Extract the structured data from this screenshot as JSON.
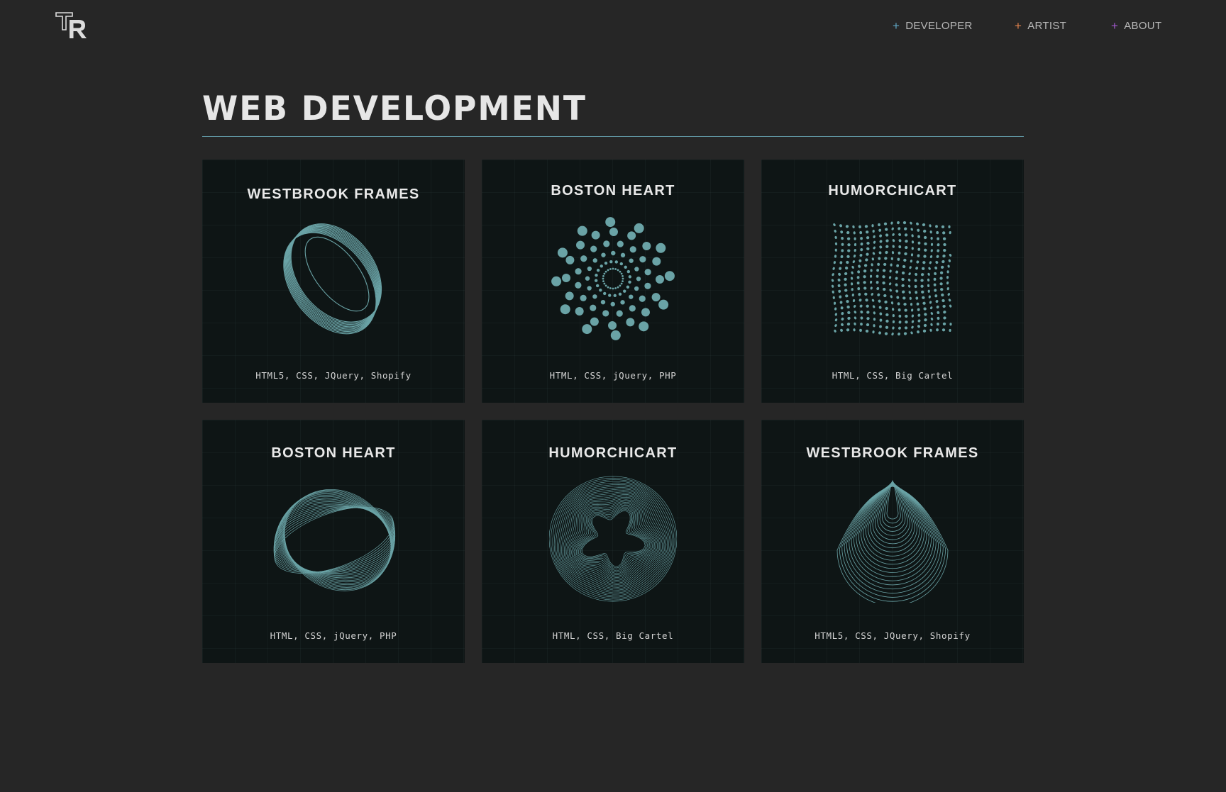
{
  "header": {
    "logo_text": "TR",
    "nav": [
      {
        "label": "DEVELOPER",
        "plus": "+",
        "color": "#5fa6c4"
      },
      {
        "label": "ARTIST",
        "plus": "+",
        "color": "#e0824d"
      },
      {
        "label": "ABOUT",
        "plus": "+",
        "color": "#a45ad1"
      }
    ]
  },
  "main": {
    "title": "WEB DEVELOPMENT",
    "accent_color": "#5f93a0",
    "art_color": "#6aa3a6",
    "projects": [
      {
        "title": "WESTBROOK FRAMES",
        "tech": "HTML5, CSS, JQuery, Shopify",
        "icon": "ring-coil-icon"
      },
      {
        "title": "BOSTON HEART",
        "tech": "HTML, CSS, jQuery, PHP",
        "icon": "radial-dots-icon"
      },
      {
        "title": "HUMORCHICART",
        "tech": "HTML, CSS, Big Cartel",
        "icon": "wave-dot-grid-icon"
      },
      {
        "title": "BOSTON HEART",
        "tech": "HTML, CSS, jQuery, PHP",
        "icon": "twisted-loop-icon"
      },
      {
        "title": "HUMORCHICART",
        "tech": "HTML, CSS, Big Cartel",
        "icon": "blob-circle-icon"
      },
      {
        "title": "WESTBROOK FRAMES",
        "tech": "HTML5, CSS, JQuery, Shopify",
        "icon": "teardrop-contour-icon"
      }
    ]
  }
}
